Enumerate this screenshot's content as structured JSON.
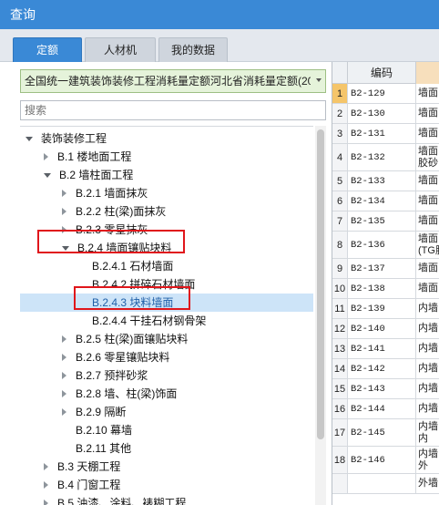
{
  "window": {
    "title": "查询"
  },
  "tabs": [
    {
      "label": "定额",
      "active": true
    },
    {
      "label": "人材机",
      "active": false
    },
    {
      "label": "我的数据",
      "active": false
    }
  ],
  "quota_library": {
    "selected": "全国统一建筑装饰装修工程消耗量定额河北省消耗量定额(20"
  },
  "search": {
    "placeholder": "搜索"
  },
  "tree": [
    {
      "label": "装饰装修工程",
      "level": 0,
      "state": "expanded"
    },
    {
      "label": "B.1 楼地面工程",
      "level": 1,
      "state": "collapsed"
    },
    {
      "label": "B.2 墙柱面工程",
      "level": 1,
      "state": "expanded"
    },
    {
      "label": "B.2.1 墙面抹灰",
      "level": 2,
      "state": "collapsed"
    },
    {
      "label": "B.2.2 柱(梁)面抹灰",
      "level": 2,
      "state": "collapsed"
    },
    {
      "label": "B.2.3 零星抹灰",
      "level": 2,
      "state": "collapsed"
    },
    {
      "label": "B.2.4 墙面镶贴块料",
      "level": 2,
      "state": "expanded"
    },
    {
      "label": "B.2.4.1 石材墙面",
      "level": 3,
      "state": "leaf"
    },
    {
      "label": "B.2.4.2 拼碎石材墙面",
      "level": 3,
      "state": "leaf"
    },
    {
      "label": "B.2.4.3 块料墙面",
      "level": 3,
      "state": "leaf",
      "selected": true
    },
    {
      "label": "B.2.4.4 干挂石材钢骨架",
      "level": 3,
      "state": "leaf"
    },
    {
      "label": "B.2.5 柱(梁)面镶贴块料",
      "level": 2,
      "state": "collapsed"
    },
    {
      "label": "B.2.6 零星镶贴块料",
      "level": 2,
      "state": "collapsed"
    },
    {
      "label": "B.2.7 预拌砂浆",
      "level": 2,
      "state": "collapsed"
    },
    {
      "label": "B.2.8 墙、柱(梁)饰面",
      "level": 2,
      "state": "collapsed"
    },
    {
      "label": "B.2.9 隔断",
      "level": 2,
      "state": "collapsed"
    },
    {
      "label": "B.2.10 幕墙",
      "level": 2,
      "state": "leaf"
    },
    {
      "label": "B.2.11 其他",
      "level": 2,
      "state": "leaf"
    },
    {
      "label": "B.3 天棚工程",
      "level": 1,
      "state": "collapsed"
    },
    {
      "label": "B.4 门窗工程",
      "level": 1,
      "state": "collapsed"
    },
    {
      "label": "B.5 油漆、涂料、裱糊工程",
      "level": 1,
      "state": "collapsed"
    }
  ],
  "grid": {
    "header_code": "编码",
    "rows": [
      {
        "num": "1",
        "code": "B2-129",
        "name": "墙面"
      },
      {
        "num": "2",
        "code": "B2-130",
        "name": "墙面"
      },
      {
        "num": "3",
        "code": "B2-131",
        "name": "墙面"
      },
      {
        "num": "4",
        "code": "B2-132",
        "name": "墙面\n胶砂"
      },
      {
        "num": "5",
        "code": "B2-133",
        "name": "墙面"
      },
      {
        "num": "6",
        "code": "B2-134",
        "name": "墙面"
      },
      {
        "num": "7",
        "code": "B2-135",
        "name": "墙面"
      },
      {
        "num": "8",
        "code": "B2-136",
        "name": "墙面\n(TG胶"
      },
      {
        "num": "9",
        "code": "B2-137",
        "name": "墙面"
      },
      {
        "num": "10",
        "code": "B2-138",
        "name": "墙面"
      },
      {
        "num": "11",
        "code": "B2-139",
        "name": "内墙"
      },
      {
        "num": "12",
        "code": "B2-140",
        "name": "内墙"
      },
      {
        "num": "13",
        "code": "B2-141",
        "name": "内墙"
      },
      {
        "num": "14",
        "code": "B2-142",
        "name": "内墙"
      },
      {
        "num": "15",
        "code": "B2-143",
        "name": "内墙"
      },
      {
        "num": "16",
        "code": "B2-144",
        "name": "内墙"
      },
      {
        "num": "17",
        "code": "B2-145",
        "name": "内墙\n内"
      },
      {
        "num": "18",
        "code": "B2-146",
        "name": "内墙\n外"
      },
      {
        "num": "",
        "code": "",
        "name": "外墙"
      }
    ]
  }
}
